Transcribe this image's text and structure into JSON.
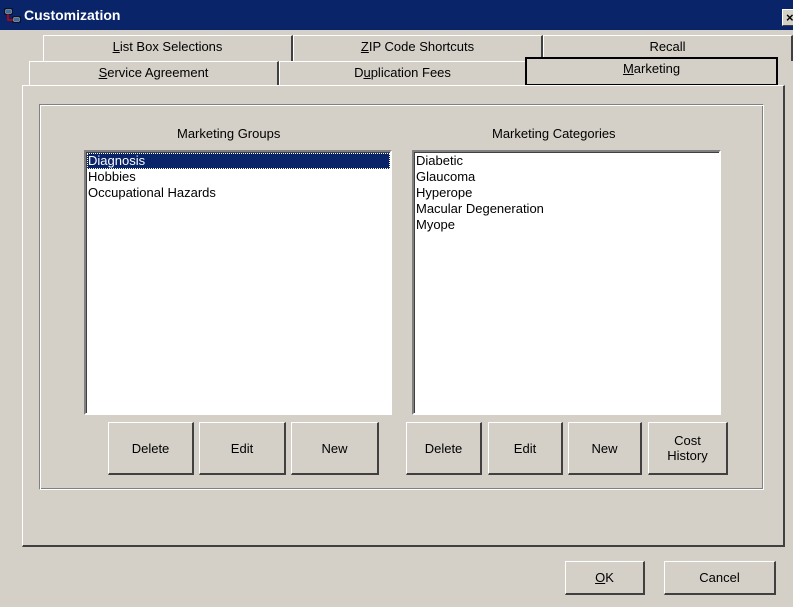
{
  "window": {
    "title": "Customization",
    "close_glyph": "×"
  },
  "tabs_back": [
    {
      "label": "List Box Selections",
      "mnemonic": "L",
      "rest": "ist Box Selections"
    },
    {
      "label": "ZIP Code Shortcuts",
      "mnemonic": "Z",
      "rest": "IP Code Shortcuts"
    },
    {
      "label": "Recall"
    }
  ],
  "tabs_front": [
    {
      "label": "Service Agreement",
      "mnemonic": "S",
      "rest": "ervice Agreement"
    },
    {
      "label": "Duplication Fees",
      "pre": "D",
      "mnemonic": "u",
      "rest": "plication Fees"
    },
    {
      "label": "Marketing",
      "mnemonic": "M",
      "rest": "arketing",
      "active": true
    }
  ],
  "marketing_groups": {
    "label": "Marketing Groups",
    "items": [
      "Diagnosis",
      "Hobbies",
      "Occupational Hazards"
    ],
    "selected": "Diagnosis",
    "buttons": {
      "delete": "Delete",
      "edit": "Edit",
      "new": "New"
    }
  },
  "marketing_categories": {
    "label": "Marketing Categories",
    "items": [
      "Diabetic",
      "Glaucoma",
      "Hyperope",
      "Macular Degeneration",
      "Myope"
    ],
    "buttons": {
      "delete": "Delete",
      "edit": "Edit",
      "new": "New",
      "cost": "Cost",
      "history": "History"
    }
  },
  "footer": {
    "ok_mnemonic": "O",
    "ok_rest": "K",
    "ok_label": "OK",
    "cancel": "Cancel"
  },
  "colors": {
    "titlebar": "#0a246a",
    "face": "#d4d0c8",
    "selection": "#0a246a"
  }
}
